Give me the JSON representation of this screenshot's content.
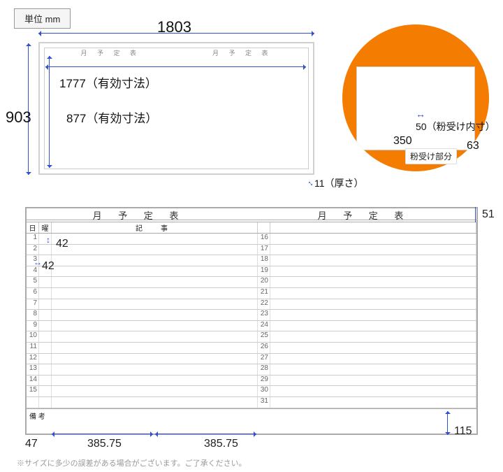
{
  "unit_label": "単位 mm",
  "top_view": {
    "width": "1803",
    "height": "903",
    "eff_w": "1777（有効寸法）",
    "eff_h": "877（有効寸法）",
    "thickness": "11（厚さ）",
    "header": "月 予 定 表"
  },
  "tray": {
    "inner": "50（粉受け内寸）",
    "length": "350",
    "depth": "63",
    "label": "粉受け部分"
  },
  "schedule": {
    "title": "月 予 定 表",
    "day_hdr": "日",
    "weekday_hdr": "曜",
    "note_hdr": "記　事",
    "memo_hdr": "備 考",
    "left_days": [
      "1",
      "2",
      "3",
      "4",
      "5",
      "6",
      "7",
      "8",
      "9",
      "10",
      "11",
      "12",
      "13",
      "14",
      "15"
    ],
    "right_days": [
      "16",
      "17",
      "18",
      "19",
      "20",
      "21",
      "22",
      "23",
      "24",
      "25",
      "26",
      "27",
      "28",
      "29",
      "30",
      "31"
    ]
  },
  "dims": {
    "title_h": "51",
    "row_h": "42",
    "day_w": "42",
    "col_a": "47",
    "col_b": "385.75",
    "col_c": "385.75",
    "memo_h": "115"
  },
  "footnote": "※サイズに多少の誤差がある場合がございます。ご了承ください。"
}
